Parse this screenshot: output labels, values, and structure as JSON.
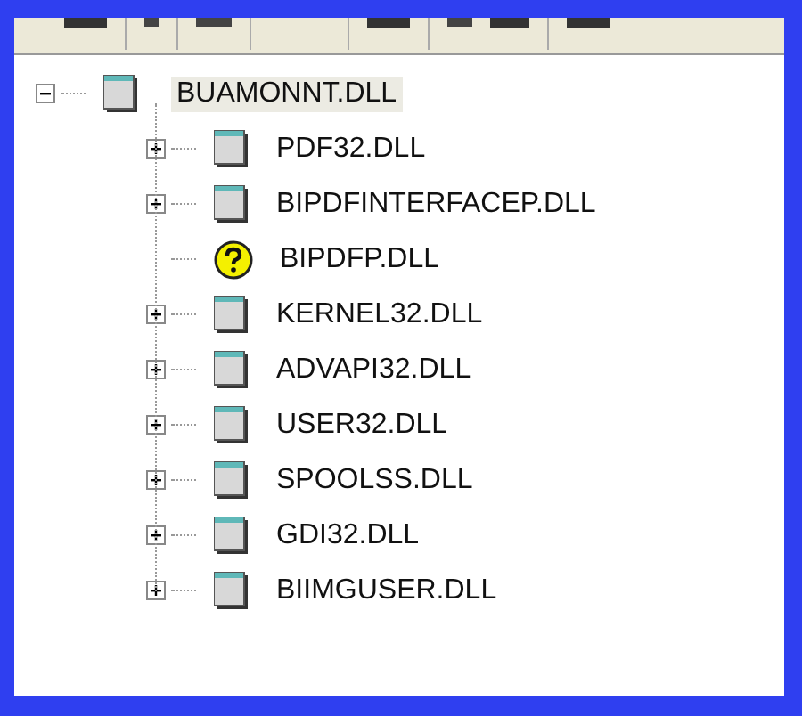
{
  "tree": {
    "name": "BUAMONNT.DLL",
    "kind": "dll",
    "expanded": true,
    "selected": true,
    "children": [
      {
        "name": "PDF32.DLL",
        "kind": "dll",
        "expandable": true
      },
      {
        "name": "BIPDFINTERFACEP.DLL",
        "kind": "dll",
        "expandable": true
      },
      {
        "name": "BIPDFP.DLL",
        "kind": "missing",
        "expandable": false
      },
      {
        "name": "KERNEL32.DLL",
        "kind": "dll",
        "expandable": true
      },
      {
        "name": "ADVAPI32.DLL",
        "kind": "dll",
        "expandable": true
      },
      {
        "name": "USER32.DLL",
        "kind": "dll",
        "expandable": true
      },
      {
        "name": "SPOOLSS.DLL",
        "kind": "dll",
        "expandable": true
      },
      {
        "name": "GDI32.DLL",
        "kind": "dll",
        "expandable": true
      },
      {
        "name": "BIIMGUSER.DLL",
        "kind": "dll",
        "expandable": true
      }
    ]
  }
}
